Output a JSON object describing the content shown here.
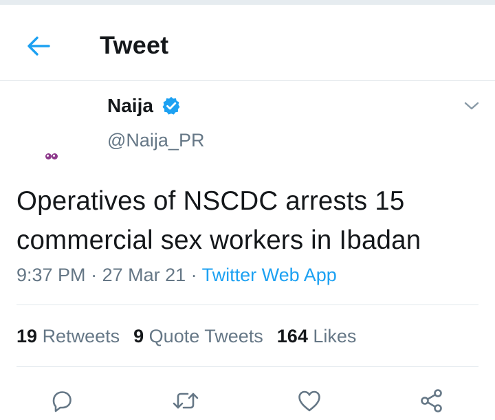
{
  "header": {
    "title": "Tweet",
    "back_icon": "arrow-left-icon"
  },
  "tweet": {
    "author_name": "Naija",
    "verified": true,
    "handle": "@Naija_PR",
    "text": "Operatives of NSCDC arrests 15 commercial sex workers in Ibadan",
    "time": "9:37 PM",
    "date": "27 Mar 21",
    "source": "Twitter Web App",
    "separator": " · "
  },
  "stats": {
    "retweets_count": "19",
    "retweets_label": "Retweets",
    "quotes_count": "9",
    "quotes_label": "Quote Tweets",
    "likes_count": "164",
    "likes_label": "Likes"
  },
  "actions": [
    "reply-icon",
    "retweet-icon",
    "like-icon",
    "share-icon"
  ],
  "colors": {
    "accent": "#1da1f2",
    "text_primary": "#14171a",
    "text_secondary": "#657786",
    "divider": "#e1e8ed",
    "avatar_eyes": "#8e3a8c"
  }
}
